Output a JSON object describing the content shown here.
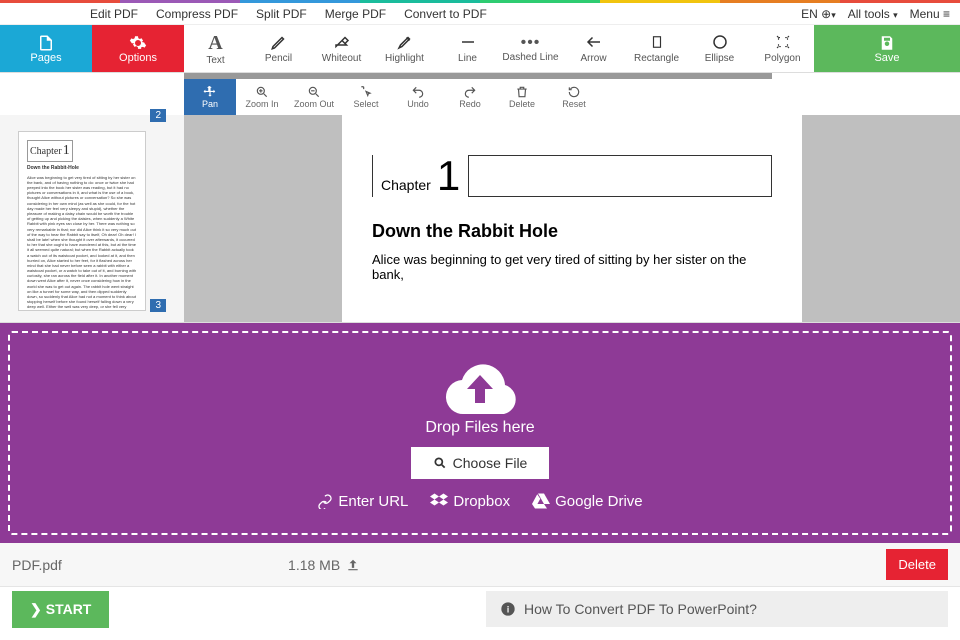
{
  "topMenu": {
    "left": [
      "Edit PDF",
      "Compress PDF",
      "Split PDF",
      "Merge PDF",
      "Convert to PDF"
    ],
    "lang": "EN",
    "tools": "All tools",
    "menu": "Menu"
  },
  "toolbar": {
    "pages": "Pages",
    "options": "Options",
    "save": "Save",
    "tools": [
      "Text",
      "Pencil",
      "Whiteout",
      "Highlight",
      "Line",
      "Dashed Line",
      "Arrow",
      "Rectangle",
      "Ellipse",
      "Polygon"
    ]
  },
  "editorTools": [
    "Pan",
    "Zoom In",
    "Zoom Out",
    "Select",
    "Undo",
    "Redo",
    "Delete",
    "Reset"
  ],
  "thumbs": {
    "badge1": "2",
    "badge2": "3",
    "chapter": "Chapter",
    "num": "1",
    "title": "Down the Rabbit-Hole"
  },
  "page": {
    "chapter": "Chapter",
    "num": "1",
    "title": "Down the Rabbit Hole",
    "text": "Alice was beginning to get very tired of sitting by her sister on the bank,"
  },
  "dropzone": {
    "drop": "Drop Files here",
    "choose": "Choose File",
    "url": "Enter URL",
    "dropbox": "Dropbox",
    "gdrive": "Google Drive"
  },
  "file": {
    "name": "PDF.pdf",
    "size": "1.18 MB",
    "delete": "Delete"
  },
  "bottom": {
    "start": "START",
    "howto": "How To Convert PDF To PowerPoint?"
  }
}
